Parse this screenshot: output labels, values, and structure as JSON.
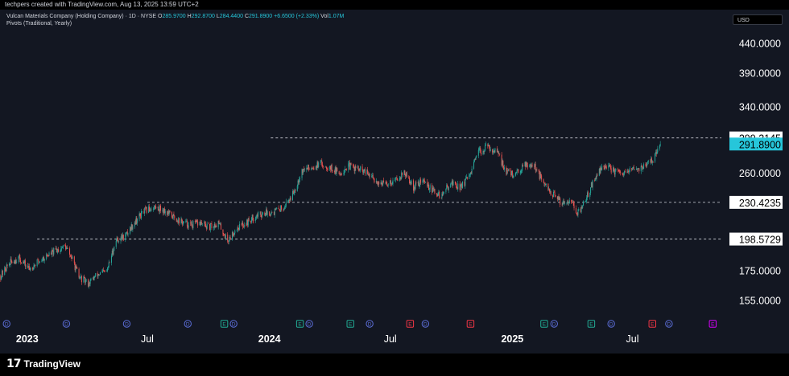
{
  "header": {
    "attribution": "techpers created with TradingView.com, Aug 13, 2025 13:59 UTC+2"
  },
  "legend": {
    "symbol": "Vulcan Materials Company (Holding Company) · 1D · NYSE",
    "o_label": "O",
    "o_value": "285.9700",
    "h_label": "H",
    "h_value": "292.8700",
    "l_label": "L",
    "l_value": "284.4400",
    "c_label": "C",
    "c_value": "291.8900",
    "change": "+6.6500 (+2.33%)",
    "vol_label": "Vol",
    "vol_value": "1.07M",
    "indicator": "Pivots (Traditional, Yearly)"
  },
  "currency": "USD",
  "brand": {
    "logo": "17",
    "name": "TradingView"
  },
  "colors": {
    "background": "#131722",
    "up": "#26a69a",
    "down": "#ef5350",
    "text": "#d1d4dc",
    "price_badge": "#26c6da",
    "pivot_line": "#d1d4dc"
  },
  "chart_data": {
    "type": "candlestick",
    "title": "Vulcan Materials Company (Holding Company) · 1D · NYSE",
    "x_ticks": [
      {
        "label": "2023",
        "date": "2023-01-01",
        "bold": true
      },
      {
        "label": "Jul",
        "date": "2023-07-01",
        "bold": false
      },
      {
        "label": "2024",
        "date": "2024-01-01",
        "bold": true
      },
      {
        "label": "Jul",
        "date": "2024-07-01",
        "bold": false
      },
      {
        "label": "2025",
        "date": "2025-01-01",
        "bold": true
      },
      {
        "label": "Jul",
        "date": "2025-07-01",
        "bold": false
      }
    ],
    "x_range": [
      "2022-11-21",
      "2025-11-12"
    ],
    "y_scale": "log",
    "y_range": [
      146,
      500
    ],
    "y_ticks": [
      "155.0000",
      "175.0000",
      "260.0000",
      "340.0000",
      "390.0000",
      "440.0000"
    ],
    "pivot_levels": [
      {
        "label": "198.5729",
        "value": 198.5729,
        "start": "2023-01-16"
      },
      {
        "label": "230.4235",
        "value": 230.4235,
        "start": "2023-07-01"
      },
      {
        "label": "299.2145",
        "value": 299.2145,
        "start": "2024-01-03"
      }
    ],
    "last_price": {
      "label": "291.8900",
      "value": 291.89
    },
    "close_path": [
      [
        "2022-11-22",
        171
      ],
      [
        "2022-12-05",
        180
      ],
      [
        "2022-12-19",
        184
      ],
      [
        "2023-01-04",
        176
      ],
      [
        "2023-01-17",
        181
      ],
      [
        "2023-02-01",
        186
      ],
      [
        "2023-02-15",
        190
      ],
      [
        "2023-02-27",
        193
      ],
      [
        "2023-03-09",
        184
      ],
      [
        "2023-03-20",
        170
      ],
      [
        "2023-04-03",
        166
      ],
      [
        "2023-04-17",
        172
      ],
      [
        "2023-05-01",
        174
      ],
      [
        "2023-05-15",
        198
      ],
      [
        "2023-05-29",
        201
      ],
      [
        "2023-06-12",
        213
      ],
      [
        "2023-06-26",
        222
      ],
      [
        "2023-07-10",
        226
      ],
      [
        "2023-07-24",
        224
      ],
      [
        "2023-08-07",
        218
      ],
      [
        "2023-08-21",
        213
      ],
      [
        "2023-09-04",
        210
      ],
      [
        "2023-09-18",
        212
      ],
      [
        "2023-10-02",
        208
      ],
      [
        "2023-10-16",
        212
      ],
      [
        "2023-10-30",
        197
      ],
      [
        "2023-11-13",
        208
      ],
      [
        "2023-11-27",
        212
      ],
      [
        "2023-12-11",
        218
      ],
      [
        "2023-12-25",
        221
      ],
      [
        "2024-01-08",
        222
      ],
      [
        "2024-01-22",
        226
      ],
      [
        "2024-02-05",
        238
      ],
      [
        "2024-02-19",
        262
      ],
      [
        "2024-03-04",
        266
      ],
      [
        "2024-03-18",
        269
      ],
      [
        "2024-04-01",
        266
      ],
      [
        "2024-04-15",
        259
      ],
      [
        "2024-04-29",
        267
      ],
      [
        "2024-05-13",
        264
      ],
      [
        "2024-05-27",
        259
      ],
      [
        "2024-06-10",
        251
      ],
      [
        "2024-06-24",
        248
      ],
      [
        "2024-07-08",
        252
      ],
      [
        "2024-07-22",
        260
      ],
      [
        "2024-08-05",
        245
      ],
      [
        "2024-08-19",
        252
      ],
      [
        "2024-09-02",
        242
      ],
      [
        "2024-09-16",
        236
      ],
      [
        "2024-09-30",
        250
      ],
      [
        "2024-10-14",
        245
      ],
      [
        "2024-10-28",
        255
      ],
      [
        "2024-11-11",
        282
      ],
      [
        "2024-11-25",
        289
      ],
      [
        "2024-12-09",
        282
      ],
      [
        "2024-12-23",
        261
      ],
      [
        "2025-01-06",
        257
      ],
      [
        "2025-01-20",
        270
      ],
      [
        "2025-02-03",
        268
      ],
      [
        "2025-02-17",
        248
      ],
      [
        "2025-03-03",
        238
      ],
      [
        "2025-03-17",
        230
      ],
      [
        "2025-03-31",
        234
      ],
      [
        "2025-04-08",
        218
      ],
      [
        "2025-04-21",
        232
      ],
      [
        "2025-05-05",
        254
      ],
      [
        "2025-05-19",
        268
      ],
      [
        "2025-06-02",
        262
      ],
      [
        "2025-06-16",
        257
      ],
      [
        "2025-06-30",
        263
      ],
      [
        "2025-07-14",
        265
      ],
      [
        "2025-07-28",
        271
      ],
      [
        "2025-08-07",
        282
      ],
      [
        "2025-08-12",
        291.89
      ]
    ],
    "event_markers": [
      {
        "date": "2022-12-01",
        "letter": "D",
        "color": "#5b6dd6"
      },
      {
        "date": "2023-03-01",
        "letter": "D",
        "color": "#5b6dd6"
      },
      {
        "date": "2023-05-31",
        "letter": "D",
        "color": "#5b6dd6"
      },
      {
        "date": "2023-08-31",
        "letter": "D",
        "color": "#5b6dd6"
      },
      {
        "date": "2023-10-25",
        "letter": "E",
        "color": "#22ab94"
      },
      {
        "date": "2023-11-08",
        "letter": "D",
        "color": "#5b6dd6"
      },
      {
        "date": "2024-02-16",
        "letter": "E",
        "color": "#22ab94"
      },
      {
        "date": "2024-03-01",
        "letter": "D",
        "color": "#5b6dd6"
      },
      {
        "date": "2024-05-02",
        "letter": "E",
        "color": "#22ab94"
      },
      {
        "date": "2024-05-31",
        "letter": "D",
        "color": "#5b6dd6"
      },
      {
        "date": "2024-07-31",
        "letter": "E",
        "color": "#f23645"
      },
      {
        "date": "2024-08-23",
        "letter": "D",
        "color": "#5b6dd6"
      },
      {
        "date": "2024-10-30",
        "letter": "E",
        "color": "#f23645"
      },
      {
        "date": "2025-02-18",
        "letter": "E",
        "color": "#22ab94"
      },
      {
        "date": "2025-03-05",
        "letter": "D",
        "color": "#5b6dd6"
      },
      {
        "date": "2025-04-30",
        "letter": "E",
        "color": "#22ab94"
      },
      {
        "date": "2025-05-30",
        "letter": "D",
        "color": "#5b6dd6"
      },
      {
        "date": "2025-07-31",
        "letter": "E",
        "color": "#f23645"
      },
      {
        "date": "2025-08-25",
        "letter": "D",
        "color": "#5b6dd6"
      },
      {
        "date": "2025-10-30",
        "letter": "E",
        "color": "#d500f9"
      }
    ]
  }
}
